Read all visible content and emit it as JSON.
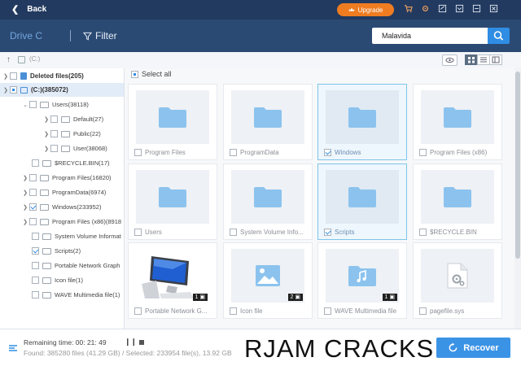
{
  "topbar": {
    "back_label": "Back",
    "upgrade_label": "Upgrade"
  },
  "navbar": {
    "drive_label": "Drive C",
    "filter_label": "Filter",
    "search_value": "Malavida"
  },
  "pathbar": {
    "path": "(C:)"
  },
  "tree": {
    "deleted": "Deleted files(205)",
    "root": "(C:)(385072)",
    "items": [
      "Users(38118)",
      "Default(27)",
      "Public(22)",
      "User(38068)",
      "$RECYCLE.BIN(17)",
      "Program Files(16820)",
      "ProgramData(6974)",
      "Windows(233952)",
      "Program Files (x86)(8918",
      "System Volume Informat",
      "Scripts(2)",
      "Portable Network Graph",
      "Icon file(1)",
      "WAVE Multimedia file(1)"
    ]
  },
  "grid": {
    "select_all": "Select all",
    "cards": [
      {
        "name": "Program Files",
        "checked": false
      },
      {
        "name": "ProgramData",
        "checked": false
      },
      {
        "name": "Windows",
        "checked": true
      },
      {
        "name": "Program Files (x86)",
        "checked": false
      },
      {
        "name": "Users",
        "checked": false
      },
      {
        "name": "System Volume Info...",
        "checked": false
      },
      {
        "name": "Scripts",
        "checked": true
      },
      {
        "name": "$RECYCLE.BIN",
        "checked": false
      },
      {
        "name": "Portable Network G...",
        "checked": false,
        "count": "1"
      },
      {
        "name": "Icon file",
        "checked": false,
        "count": "2"
      },
      {
        "name": "WAVE Multimedia file",
        "checked": false,
        "count": "1"
      },
      {
        "name": "pagefile.sys",
        "checked": false
      }
    ]
  },
  "status": {
    "remaining": "Remaining time: 00: 21: 49",
    "found": "Found: 385280 files (41.29 GB) / Selected: 233954 file(s), 13.92 GB",
    "watermark": "RJAM CRACKS",
    "recover_label": "Recover"
  },
  "colors": {
    "accent": "#2f8de4",
    "topbar": "#223a5f",
    "navbar": "#2b4a73",
    "upgrade": "#f07c21"
  }
}
